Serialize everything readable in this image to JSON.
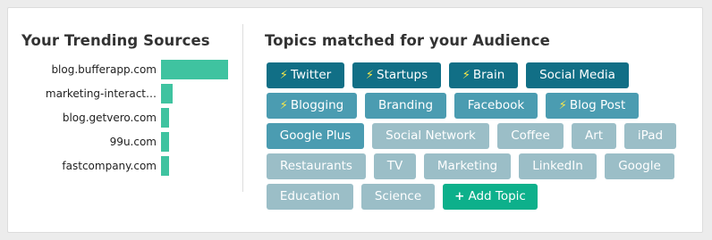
{
  "sources_panel": {
    "title": "Your Trending Sources",
    "accent_color": "#3fc3a0",
    "items": [
      {
        "name": "blog.bufferapp.com",
        "share": 1.0
      },
      {
        "name": "marketing-interact…",
        "share": 0.17
      },
      {
        "name": "blog.getvero.com",
        "share": 0.12
      },
      {
        "name": "99u.com",
        "share": 0.12
      },
      {
        "name": "fastcompany.com",
        "share": 0.12
      }
    ]
  },
  "topics_panel": {
    "title": "Topics matched for your Audience",
    "trending_icon": "lightning-bolt-icon",
    "colors": {
      "dark": "#116f86",
      "mid": "#4b9cb1",
      "light": "#9bbec7",
      "add": "#0db08b"
    },
    "rows": [
      [
        {
          "label": "Twitter",
          "trending": true,
          "tone": "dark"
        },
        {
          "label": "Startups",
          "trending": true,
          "tone": "dark"
        },
        {
          "label": "Brain",
          "trending": true,
          "tone": "dark"
        },
        {
          "label": "Social Media",
          "trending": false,
          "tone": "dark"
        }
      ],
      [
        {
          "label": "Blogging",
          "trending": true,
          "tone": "mid"
        },
        {
          "label": "Branding",
          "trending": false,
          "tone": "mid"
        },
        {
          "label": "Facebook",
          "trending": false,
          "tone": "mid"
        },
        {
          "label": "Blog Post",
          "trending": true,
          "tone": "mid"
        }
      ],
      [
        {
          "label": "Google Plus",
          "trending": false,
          "tone": "mid"
        },
        {
          "label": "Social Network",
          "trending": false,
          "tone": "light"
        },
        {
          "label": "Coffee",
          "trending": false,
          "tone": "light"
        },
        {
          "label": "Art",
          "trending": false,
          "tone": "light"
        },
        {
          "label": "iPad",
          "trending": false,
          "tone": "light"
        }
      ],
      [
        {
          "label": "Restaurants",
          "trending": false,
          "tone": "light"
        },
        {
          "label": "TV",
          "trending": false,
          "tone": "light"
        },
        {
          "label": "Marketing",
          "trending": false,
          "tone": "light"
        },
        {
          "label": "LinkedIn",
          "trending": false,
          "tone": "light"
        },
        {
          "label": "Google",
          "trending": false,
          "tone": "light"
        }
      ],
      [
        {
          "label": "Education",
          "trending": false,
          "tone": "light"
        },
        {
          "label": "Science",
          "trending": false,
          "tone": "light"
        }
      ]
    ],
    "add_button": {
      "label": "Add Topic",
      "icon": "plus-icon"
    }
  }
}
